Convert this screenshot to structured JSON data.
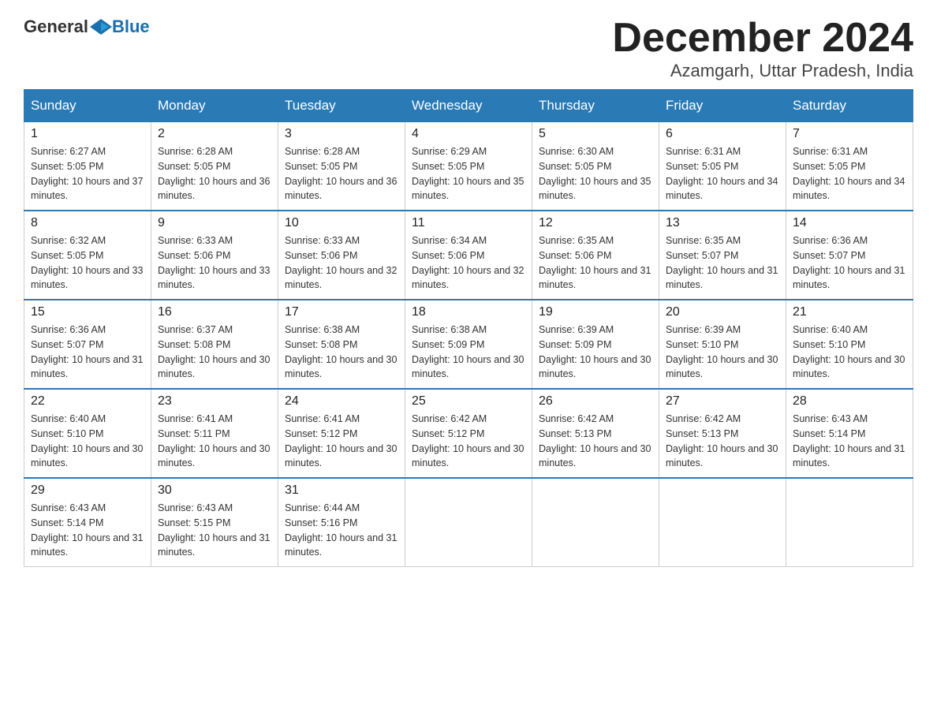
{
  "header": {
    "logo_general": "General",
    "logo_blue": "Blue",
    "month_year": "December 2024",
    "location": "Azamgarh, Uttar Pradesh, India"
  },
  "weekdays": [
    "Sunday",
    "Monday",
    "Tuesday",
    "Wednesday",
    "Thursday",
    "Friday",
    "Saturday"
  ],
  "weeks": [
    [
      {
        "day": "1",
        "sunrise": "6:27 AM",
        "sunset": "5:05 PM",
        "daylight": "10 hours and 37 minutes."
      },
      {
        "day": "2",
        "sunrise": "6:28 AM",
        "sunset": "5:05 PM",
        "daylight": "10 hours and 36 minutes."
      },
      {
        "day": "3",
        "sunrise": "6:28 AM",
        "sunset": "5:05 PM",
        "daylight": "10 hours and 36 minutes."
      },
      {
        "day": "4",
        "sunrise": "6:29 AM",
        "sunset": "5:05 PM",
        "daylight": "10 hours and 35 minutes."
      },
      {
        "day": "5",
        "sunrise": "6:30 AM",
        "sunset": "5:05 PM",
        "daylight": "10 hours and 35 minutes."
      },
      {
        "day": "6",
        "sunrise": "6:31 AM",
        "sunset": "5:05 PM",
        "daylight": "10 hours and 34 minutes."
      },
      {
        "day": "7",
        "sunrise": "6:31 AM",
        "sunset": "5:05 PM",
        "daylight": "10 hours and 34 minutes."
      }
    ],
    [
      {
        "day": "8",
        "sunrise": "6:32 AM",
        "sunset": "5:05 PM",
        "daylight": "10 hours and 33 minutes."
      },
      {
        "day": "9",
        "sunrise": "6:33 AM",
        "sunset": "5:06 PM",
        "daylight": "10 hours and 33 minutes."
      },
      {
        "day": "10",
        "sunrise": "6:33 AM",
        "sunset": "5:06 PM",
        "daylight": "10 hours and 32 minutes."
      },
      {
        "day": "11",
        "sunrise": "6:34 AM",
        "sunset": "5:06 PM",
        "daylight": "10 hours and 32 minutes."
      },
      {
        "day": "12",
        "sunrise": "6:35 AM",
        "sunset": "5:06 PM",
        "daylight": "10 hours and 31 minutes."
      },
      {
        "day": "13",
        "sunrise": "6:35 AM",
        "sunset": "5:07 PM",
        "daylight": "10 hours and 31 minutes."
      },
      {
        "day": "14",
        "sunrise": "6:36 AM",
        "sunset": "5:07 PM",
        "daylight": "10 hours and 31 minutes."
      }
    ],
    [
      {
        "day": "15",
        "sunrise": "6:36 AM",
        "sunset": "5:07 PM",
        "daylight": "10 hours and 31 minutes."
      },
      {
        "day": "16",
        "sunrise": "6:37 AM",
        "sunset": "5:08 PM",
        "daylight": "10 hours and 30 minutes."
      },
      {
        "day": "17",
        "sunrise": "6:38 AM",
        "sunset": "5:08 PM",
        "daylight": "10 hours and 30 minutes."
      },
      {
        "day": "18",
        "sunrise": "6:38 AM",
        "sunset": "5:09 PM",
        "daylight": "10 hours and 30 minutes."
      },
      {
        "day": "19",
        "sunrise": "6:39 AM",
        "sunset": "5:09 PM",
        "daylight": "10 hours and 30 minutes."
      },
      {
        "day": "20",
        "sunrise": "6:39 AM",
        "sunset": "5:10 PM",
        "daylight": "10 hours and 30 minutes."
      },
      {
        "day": "21",
        "sunrise": "6:40 AM",
        "sunset": "5:10 PM",
        "daylight": "10 hours and 30 minutes."
      }
    ],
    [
      {
        "day": "22",
        "sunrise": "6:40 AM",
        "sunset": "5:10 PM",
        "daylight": "10 hours and 30 minutes."
      },
      {
        "day": "23",
        "sunrise": "6:41 AM",
        "sunset": "5:11 PM",
        "daylight": "10 hours and 30 minutes."
      },
      {
        "day": "24",
        "sunrise": "6:41 AM",
        "sunset": "5:12 PM",
        "daylight": "10 hours and 30 minutes."
      },
      {
        "day": "25",
        "sunrise": "6:42 AM",
        "sunset": "5:12 PM",
        "daylight": "10 hours and 30 minutes."
      },
      {
        "day": "26",
        "sunrise": "6:42 AM",
        "sunset": "5:13 PM",
        "daylight": "10 hours and 30 minutes."
      },
      {
        "day": "27",
        "sunrise": "6:42 AM",
        "sunset": "5:13 PM",
        "daylight": "10 hours and 30 minutes."
      },
      {
        "day": "28",
        "sunrise": "6:43 AM",
        "sunset": "5:14 PM",
        "daylight": "10 hours and 31 minutes."
      }
    ],
    [
      {
        "day": "29",
        "sunrise": "6:43 AM",
        "sunset": "5:14 PM",
        "daylight": "10 hours and 31 minutes."
      },
      {
        "day": "30",
        "sunrise": "6:43 AM",
        "sunset": "5:15 PM",
        "daylight": "10 hours and 31 minutes."
      },
      {
        "day": "31",
        "sunrise": "6:44 AM",
        "sunset": "5:16 PM",
        "daylight": "10 hours and 31 minutes."
      },
      null,
      null,
      null,
      null
    ]
  ]
}
